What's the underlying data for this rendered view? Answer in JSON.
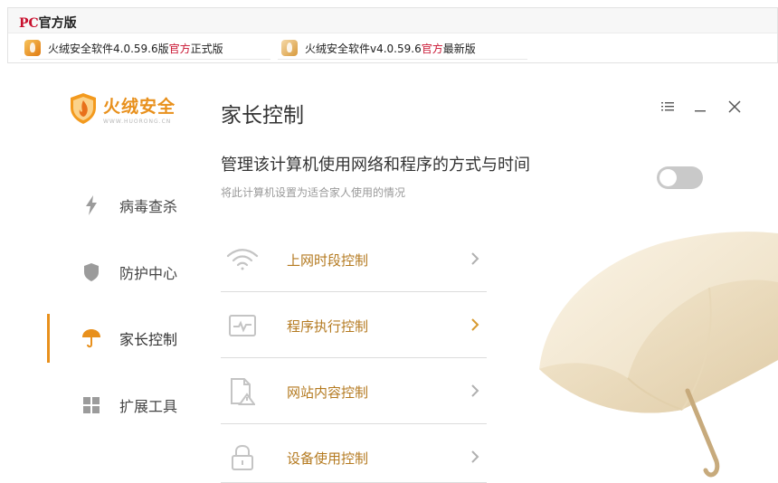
{
  "banner": {
    "title_pc": "PC",
    "title_rest": "官方版",
    "downloads": [
      {
        "prefix": "火绒安全软件4.0.59.6版",
        "highlight": "官方",
        "suffix": "正式版",
        "icon": "huorong-app-icon"
      },
      {
        "prefix": "火绒安全软件v4.0.59.6 ",
        "highlight": "官方",
        "suffix": "最新版",
        "icon": "huorong-app-icon"
      }
    ]
  },
  "logo": {
    "text": "火绒安全",
    "sub": "WWW.HUORONG.CN",
    "icon": "huorong-shield-logo"
  },
  "sidebar": {
    "items": [
      {
        "label": "病毒查杀",
        "icon": "lightning-icon",
        "active": false
      },
      {
        "label": "防护中心",
        "icon": "shield-icon",
        "active": false
      },
      {
        "label": "家长控制",
        "icon": "umbrella-icon",
        "active": true
      },
      {
        "label": "扩展工具",
        "icon": "grid-icon",
        "active": false
      }
    ]
  },
  "header": {
    "title": "家长控制"
  },
  "window_controls": [
    "menu-icon",
    "minimize-icon",
    "close-icon"
  ],
  "main": {
    "headline": "管理该计算机使用网络和程序的方式与时间",
    "subline": "将此计算机设置为适合家人使用的情况",
    "toggle_on": false,
    "rows": [
      {
        "label": "上网时段控制",
        "icon": "wifi-icon"
      },
      {
        "label": "程序执行控制",
        "icon": "program-window-icon"
      },
      {
        "label": "网站内容控制",
        "icon": "web-page-warning-icon"
      },
      {
        "label": "设备使用控制",
        "icon": "lock-icon"
      }
    ]
  },
  "colors": {
    "accent": "#e8901c",
    "label_gold": "#b47a20",
    "brand_red": "#c8102e"
  }
}
